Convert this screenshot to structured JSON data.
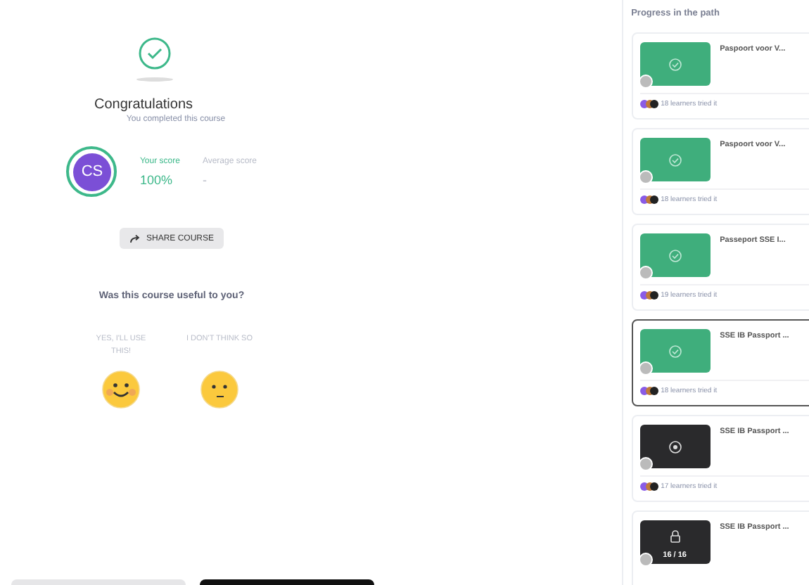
{
  "result": {
    "title": "Congratulations",
    "subtitle": "You completed this course",
    "avatar_initials": "CS",
    "your_score_label": "Your score",
    "your_score": "100%",
    "average_score_label": "Average score",
    "average_score": "-",
    "share_button": "SHARE COURSE"
  },
  "feedback": {
    "question": "Was this course useful to you?",
    "options": [
      {
        "kind": "happy",
        "label": "YES, I'LL USE THIS!"
      },
      {
        "kind": "neutral",
        "label": "I DON'T THINK SO"
      }
    ]
  },
  "path": {
    "title": "Progress in the path",
    "items": [
      {
        "title": "Paspoort voor V...",
        "kind": "completed",
        "selected": false,
        "learners": "18 learners tried it"
      },
      {
        "title": "Paspoort voor V...",
        "kind": "completed",
        "selected": false,
        "learners": "18 learners tried it"
      },
      {
        "title": "Passeport SSE I...",
        "kind": "completed",
        "selected": false,
        "learners": "19 learners tried it"
      },
      {
        "title": "SSE IB Passport ...",
        "kind": "completed",
        "selected": true,
        "learners": "18 learners tried it"
      },
      {
        "title": "SSE IB Passport ...",
        "kind": "available",
        "selected": false,
        "learners": "17 learners tried it"
      },
      {
        "title": "SSE IB Passport ...",
        "kind": "locked",
        "selected": false,
        "count": "16 / 16"
      }
    ]
  }
}
